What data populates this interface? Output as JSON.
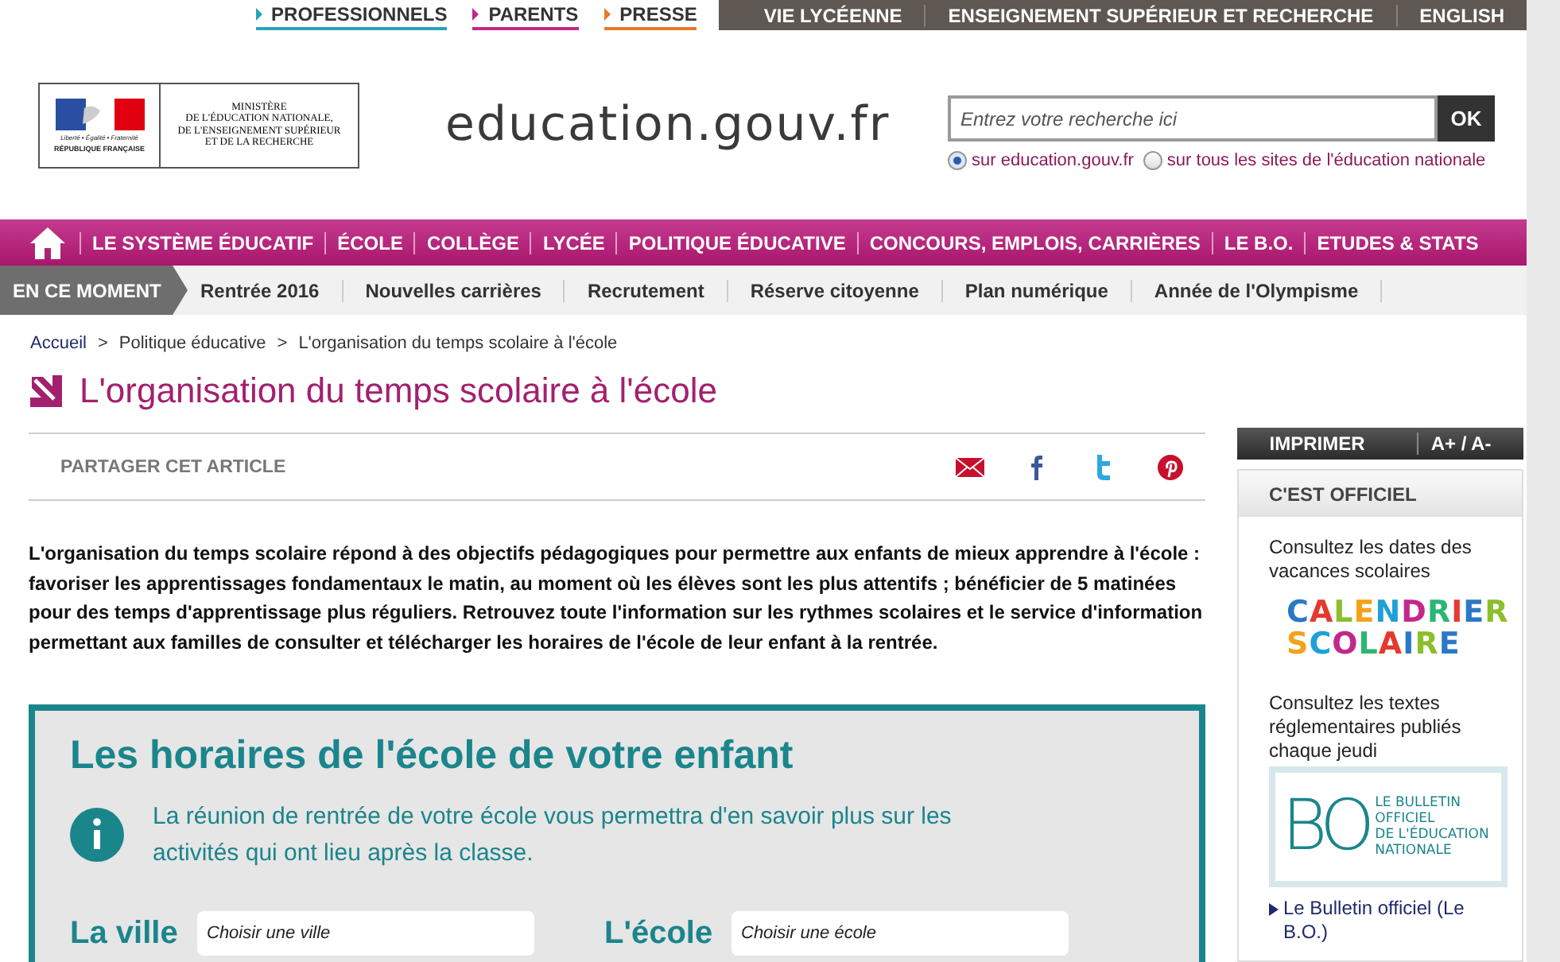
{
  "top_bar": {
    "audience_links": [
      {
        "label": "PROFESSIONNELS",
        "color": "#29a3b8"
      },
      {
        "label": "PARENTS",
        "color": "#c2288a"
      },
      {
        "label": "PRESSE",
        "color": "#e8792a"
      }
    ],
    "links": [
      "VIE LYCÉENNE",
      "ENSEIGNEMENT SUPÉRIEUR ET RECHERCHE",
      "ENGLISH"
    ]
  },
  "header": {
    "logo": {
      "motto": "Liberté • Égalité • Fraternité",
      "republic": "RÉPUBLIQUE FRANÇAISE",
      "ministry": "MINISTÈRE\nDE L'ÉDUCATION NATIONALE,\nDE L'ENSEIGNEMENT SUPÉRIEUR\nET DE LA RECHERCHE"
    },
    "site_name": "education.gouv.fr",
    "search": {
      "placeholder": "Entrez votre recherche ici",
      "button": "OK",
      "scopes": [
        {
          "label": "sur education.gouv.fr",
          "selected": true
        },
        {
          "label": "sur tous les sites de l'éducation nationale",
          "selected": false
        }
      ]
    }
  },
  "main_nav": [
    "LE SYSTÈME ÉDUCATIF",
    "ÉCOLE",
    "COLLÈGE",
    "LYCÉE",
    "POLITIQUE ÉDUCATIVE",
    "CONCOURS, EMPLOIS, CARRIÈRES",
    "LE B.O.",
    "ETUDES & STATS"
  ],
  "topics_bar": {
    "label": "EN CE MOMENT",
    "items": [
      "Rentrée 2016",
      "Nouvelles carrières",
      "Recrutement",
      "Réserve citoyenne",
      "Plan numérique",
      "Année de l'Olympisme"
    ]
  },
  "breadcrumb": [
    "Accueil",
    "Politique éducative",
    "L'organisation du temps scolaire à l'école"
  ],
  "breadcrumb_separator": ">",
  "page_title": "L'organisation du temps scolaire à l'école",
  "share": {
    "label": "PARTAGER CET ARTICLE",
    "networks": [
      {
        "kind": "mail"
      },
      {
        "kind": "facebook"
      },
      {
        "kind": "twitter"
      },
      {
        "kind": "pinterest"
      }
    ]
  },
  "intro": "L'organisation du temps scolaire répond à des objectifs pédagogiques pour permettre aux enfants de mieux apprendre à l'école : favoriser les apprentissages fondamentaux le matin, au moment où les élèves sont les plus attentifs ; bénéficier de 5 matinées pour des temps d'apprentissage plus réguliers. Retrouvez toute l'information sur les rythmes scolaires et le service d'information permettant aux familles de consulter et télécharger les horaires de l'école de leur enfant à la rentrée.",
  "school_hours": {
    "title": "Les horaires de l'école de votre enfant",
    "info": "La réunion de rentrée de votre école vous permettra d'en savoir plus sur les activités qui ont lieu après la classe.",
    "fields": [
      {
        "label": "La ville",
        "placeholder": "Choisir une ville"
      },
      {
        "label": "L'école",
        "placeholder": "Choisir une école"
      }
    ]
  },
  "sidebar": {
    "tools": [
      "IMPRIMER",
      "A+ / A-"
    ],
    "official": {
      "title": "C'EST OFFICIEL",
      "blocks": [
        {
          "text": "Consultez les dates des vacances scolaires",
          "kind": "calendar",
          "logo_lines": [
            "CALENDRIER",
            "SCOLAIRE"
          ]
        },
        {
          "text": "Consultez les textes réglementaires publiés chaque jeudi",
          "kind": "bo",
          "logo_mark": "BO",
          "logo_lines": [
            "LE BULLETIN",
            "OFFICIEL",
            "DE L'ÉDUCATION",
            "NATIONALE"
          ]
        }
      ],
      "link": "Le Bulletin officiel (Le B.O.)"
    }
  }
}
